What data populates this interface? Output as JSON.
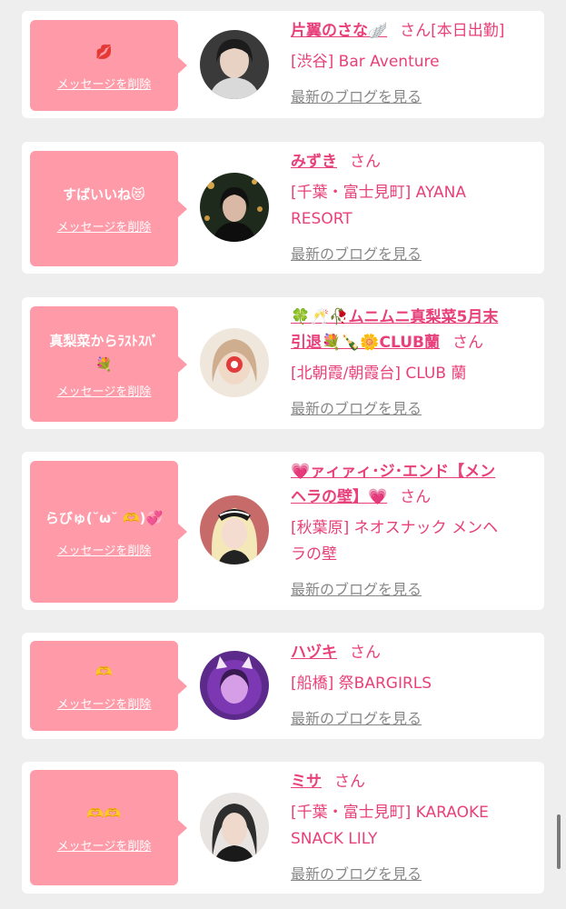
{
  "delete_label": "メッセージを削除",
  "blog_label": "最新のブログを見る",
  "cards": [
    {
      "message": "💋",
      "name": "片翼のさな🪽",
      "honorific": "さん",
      "status": "[本日出勤]",
      "shop_lines": [
        "[渋谷] Bar Aventure"
      ]
    },
    {
      "message": "すばいいね😻",
      "name": "みずき",
      "honorific": "さん",
      "shop_lines": [
        "[千葉・富士見町] AYANA",
        "RESORT"
      ]
    },
    {
      "message_lines": [
        "真梨菜からﾗｽﾄｽﾊﾞ",
        "💐"
      ],
      "name_lines": [
        "🍀🥂🥀ムニムニ真梨菜5月末",
        "引退💐🍾🌼CLUB蘭"
      ],
      "honorific": "さん",
      "shop_lines": [
        "[北朝霞/朝霞台] CLUB 蘭"
      ]
    },
    {
      "message": "らびゅ(˘ω˘ 🫶)💞",
      "name_lines": [
        "💗ァィァィ･ジ･エンド【メン",
        "ヘラの壁】💗"
      ],
      "honorific": "さん",
      "shop_lines": [
        "[秋葉原] ネオスナック メンヘ",
        "ラの壁"
      ]
    },
    {
      "message": "🫶",
      "name": "ハヅキ",
      "honorific": "さん",
      "shop_lines": [
        "[船橋] 祭BARGIRLS"
      ]
    },
    {
      "message": "🫶🫶",
      "name": "ミサ",
      "honorific": "さん",
      "shop_lines": [
        "[千葉・富士見町] KARAOKE",
        "SNACK LILY"
      ]
    }
  ]
}
